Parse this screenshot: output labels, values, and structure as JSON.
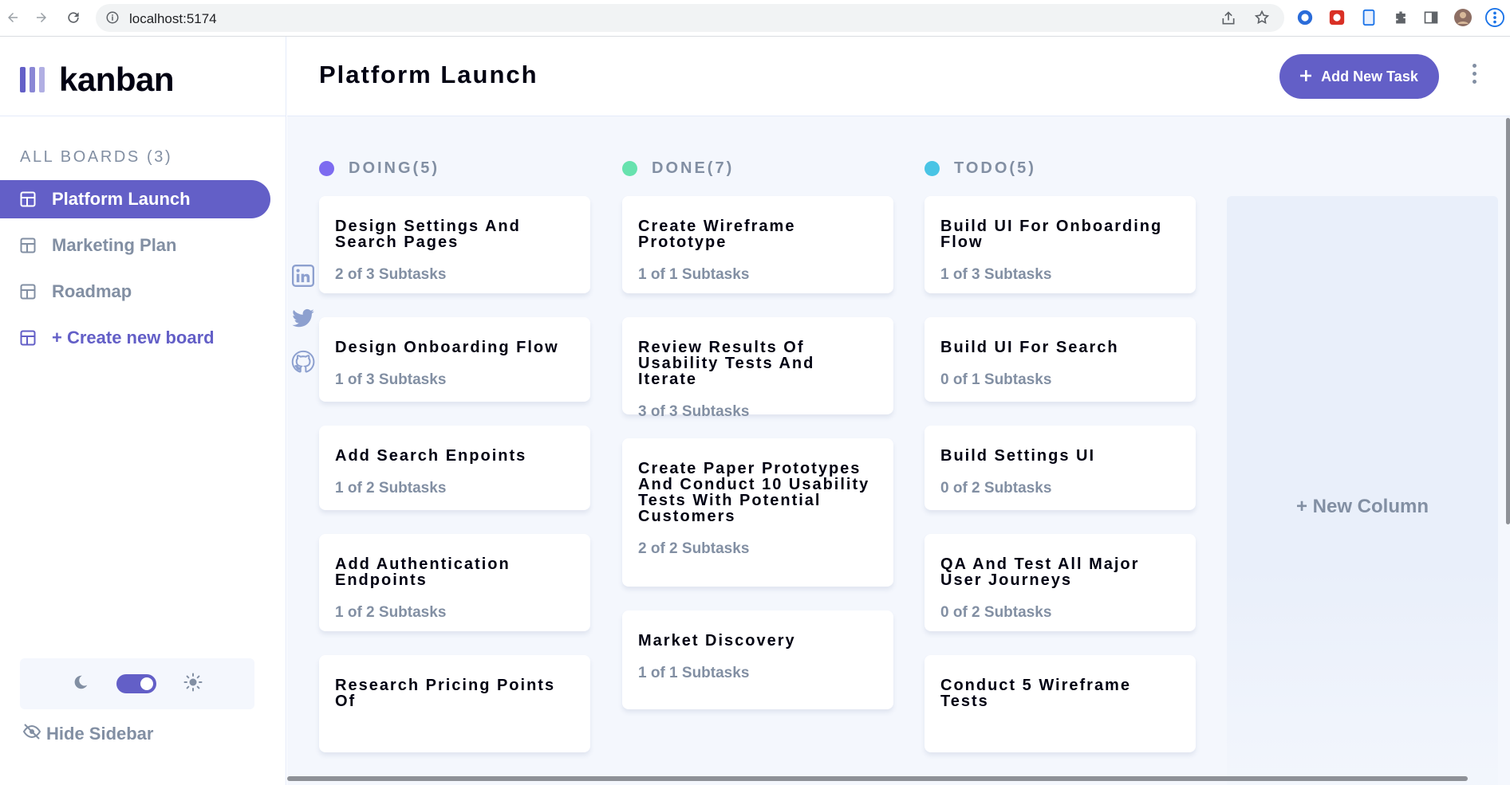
{
  "browser": {
    "url": "localhost:5174"
  },
  "sidebar": {
    "logo_text": "kanban",
    "boards_heading": "ALL BOARDS (3)",
    "boards": [
      {
        "label": "Platform Launch",
        "active": true
      },
      {
        "label": "Marketing Plan",
        "active": false
      },
      {
        "label": "Roadmap",
        "active": false
      }
    ],
    "create_label": "+ Create new board",
    "hide_label": "Hide Sidebar",
    "theme": "dark-toggle-on"
  },
  "header": {
    "board_title": "Platform Launch",
    "add_task_label": "Add New Task"
  },
  "columns": [
    {
      "name": "DOING(5)",
      "color": "#7d6bf0",
      "tasks": [
        {
          "title": "Design Settings And Search Pages",
          "subtasks": "2 of 3 Subtasks"
        },
        {
          "title": "Design Onboarding Flow",
          "subtasks": "1 of 3 Subtasks"
        },
        {
          "title": "Add Search Enpoints",
          "subtasks": "1 of 2 Subtasks"
        },
        {
          "title": "Add Authentication Endpoints",
          "subtasks": "1 of 2 Subtasks"
        },
        {
          "title": "Research Pricing Points Of",
          "subtasks": ""
        }
      ]
    },
    {
      "name": "DONE(7)",
      "color": "#67e2ae",
      "tasks": [
        {
          "title": "Create Wireframe Prototype",
          "subtasks": "1 of 1 Subtasks"
        },
        {
          "title": "Review Results Of Usability Tests And Iterate",
          "subtasks": "3 of 3 Subtasks"
        },
        {
          "title": "Create Paper Prototypes And Conduct 10 Usability Tests With Potential Customers",
          "subtasks": "2 of 2 Subtasks"
        },
        {
          "title": "Market Discovery",
          "subtasks": "1 of 1 Subtasks"
        }
      ]
    },
    {
      "name": "TODO(5)",
      "color": "#49c4e5",
      "tasks": [
        {
          "title": "Build UI For Onboarding Flow",
          "subtasks": "1 of 3 Subtasks"
        },
        {
          "title": "Build UI For Search",
          "subtasks": "0 of 1 Subtasks"
        },
        {
          "title": "Build Settings UI",
          "subtasks": "0 of 2 Subtasks"
        },
        {
          "title": "QA And Test All Major User Journeys",
          "subtasks": "0 of 2 Subtasks"
        },
        {
          "title": "Conduct 5 Wireframe Tests",
          "subtasks": ""
        }
      ]
    }
  ],
  "new_column_label": "+ New Column",
  "social": [
    "linkedin-icon",
    "twitter-icon",
    "github-icon"
  ]
}
